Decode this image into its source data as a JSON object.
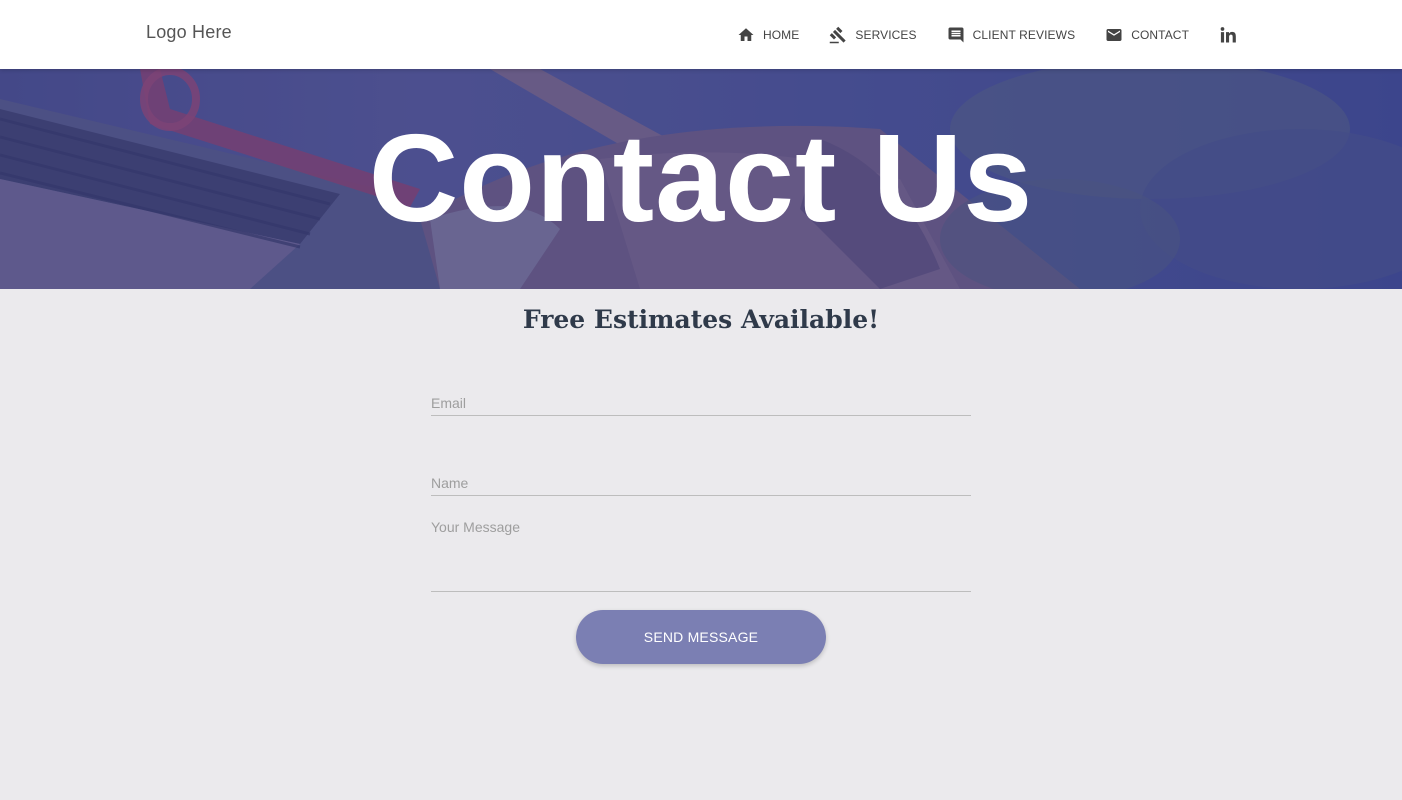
{
  "header": {
    "logo": "Logo Here",
    "nav": [
      {
        "label": "HOME",
        "icon": "home-icon"
      },
      {
        "label": "SERVICES",
        "icon": "gavel-icon"
      },
      {
        "label": "CLIENT REVIEWS",
        "icon": "comment-icon"
      },
      {
        "label": "CONTACT",
        "icon": "mail-icon"
      }
    ],
    "social_icon": "linkedin-icon"
  },
  "hero": {
    "title": "Contact Us"
  },
  "main": {
    "subtitle": "Free Estimates Available!"
  },
  "form": {
    "email_placeholder": "Email",
    "name_placeholder": "Name",
    "message_placeholder": "Your Message",
    "send_label": "SEND MESSAGE"
  },
  "colors": {
    "accent": "#7b7fb3",
    "hero_overlay": "#3c408c",
    "background": "#ebeaed",
    "heading": "#2f3a4a"
  }
}
